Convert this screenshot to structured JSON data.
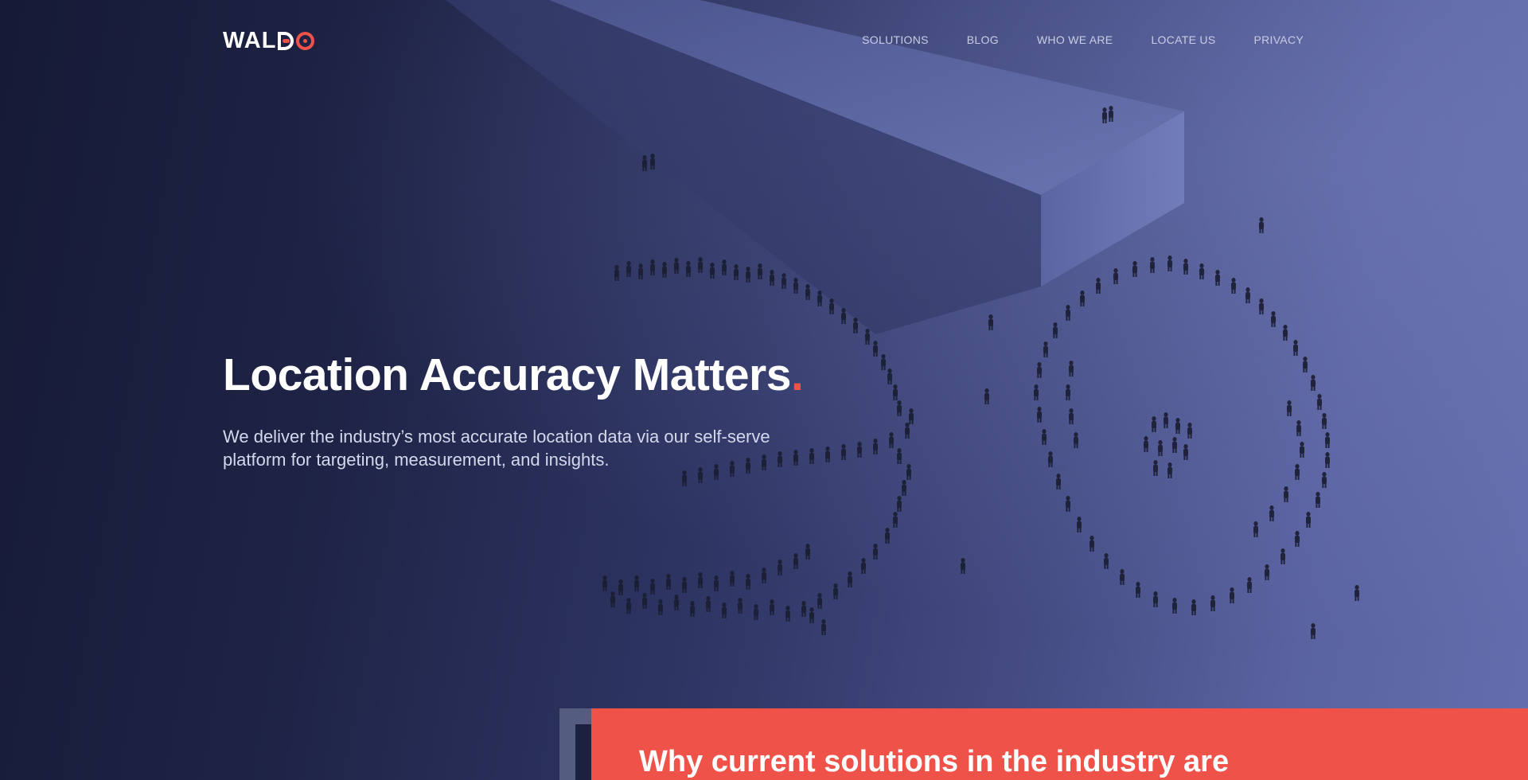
{
  "brand": {
    "logo_text": "WALDO",
    "accent_color": "#ef5249"
  },
  "nav": {
    "items": [
      {
        "label": "SOLUTIONS"
      },
      {
        "label": "BLOG"
      },
      {
        "label": "WHO WE ARE"
      },
      {
        "label": "LOCATE US"
      },
      {
        "label": "PRIVACY"
      }
    ]
  },
  "hero": {
    "headline": "Location Accuracy Matters",
    "headline_dot": ".",
    "subtext": "We deliver the industry’s most accurate location data via our self-serve platform for targeting, measurement, and insights."
  },
  "next_section": {
    "title": "Why current solutions in the industry are"
  }
}
